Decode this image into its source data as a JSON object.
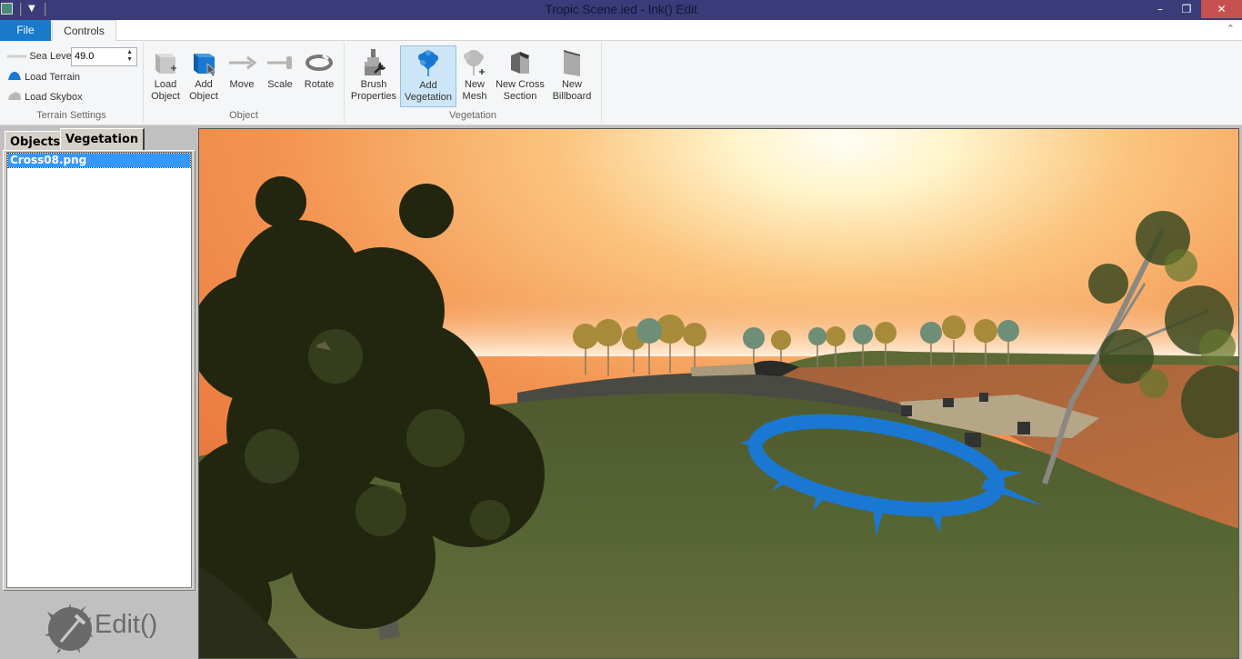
{
  "window": {
    "title": "Tropic Scene.ied - Ink() Edit",
    "controls": {
      "minimize": "–",
      "maximize": "❐",
      "close": "✕"
    },
    "qat_icon": "dropdown-arrow-icon"
  },
  "ribbon_tabs": [
    {
      "label": "File",
      "active": false,
      "color": "#1979ca"
    },
    {
      "label": "Controls",
      "active": true
    }
  ],
  "ribbon": {
    "collapse_icon": "chevron-up-icon",
    "groups": [
      {
        "label": "Terrain Settings",
        "items": [
          {
            "label": "Sea Level",
            "icon": "sea-level-icon",
            "value": "49.0"
          },
          {
            "label": "Load Terrain",
            "icon": "terrain-icon"
          },
          {
            "label": "Load Skybox",
            "icon": "skybox-icon"
          }
        ]
      },
      {
        "label": "Object",
        "buttons": [
          {
            "label": "Load\nObject",
            "icon": "load-object-icon"
          },
          {
            "label": "Add\nObject",
            "icon": "add-object-icon"
          },
          {
            "label": "Move",
            "icon": "move-icon"
          },
          {
            "label": "Scale",
            "icon": "scale-icon"
          },
          {
            "label": "Rotate",
            "icon": "rotate-icon"
          }
        ]
      },
      {
        "label": "Vegetation",
        "buttons": [
          {
            "label": "Brush\nProperties",
            "icon": "brush-properties-icon"
          },
          {
            "label": "Add\nVegetation",
            "icon": "add-vegetation-icon",
            "active": true
          },
          {
            "label": "New\nMesh",
            "icon": "new-mesh-icon"
          },
          {
            "label": "New Cross\nSection",
            "icon": "new-cross-section-icon"
          },
          {
            "label": "New\nBillboard",
            "icon": "new-billboard-icon"
          }
        ]
      }
    ]
  },
  "left_panel": {
    "tabs": [
      {
        "label": "Objects",
        "active": false
      },
      {
        "label": "Vegetation",
        "active": true
      }
    ],
    "vegetation_list": [
      {
        "label": "Cross08.png",
        "selected": true
      }
    ],
    "logo_text": "Edit()"
  },
  "viewport": {
    "description": "3D terrain scene with sunset skybox, trees, stone bridge, and blue vegetation brush cursor",
    "brush_color": "#1a78d2",
    "sky_colors": [
      "#e87a3a",
      "#f7b068",
      "#fff4d8"
    ]
  }
}
